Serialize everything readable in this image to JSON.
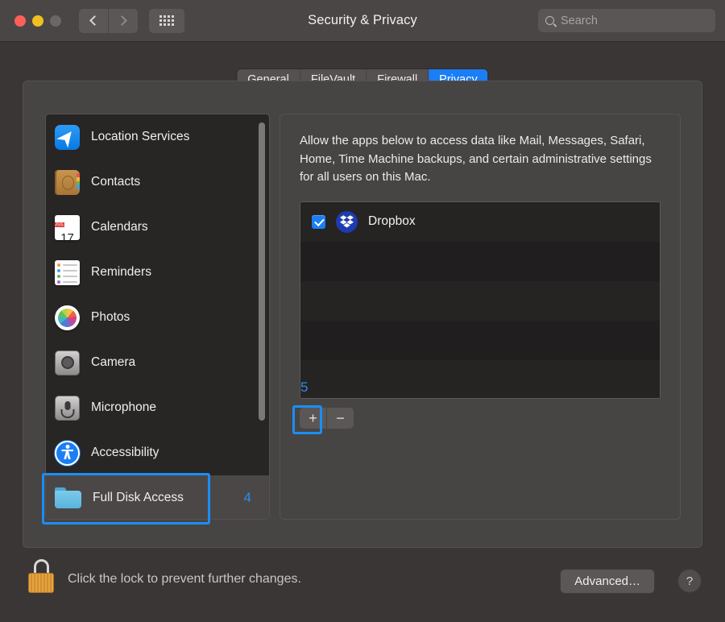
{
  "window": {
    "title": "Security & Privacy",
    "traffic_lights": [
      "close-red",
      "minimize-yellow",
      "zoom-gray"
    ],
    "nav": {
      "back": "back-chevron",
      "forward": "forward-chevron",
      "grid": "show-all-grid"
    },
    "search": {
      "placeholder": "Search",
      "value": "",
      "icon": "search-icon"
    }
  },
  "tabs": [
    {
      "label": "General",
      "active": false
    },
    {
      "label": "FileVault",
      "active": false
    },
    {
      "label": "Firewall",
      "active": false
    },
    {
      "label": "Privacy",
      "active": true
    }
  ],
  "sidebar": {
    "items": [
      {
        "label": "Location Services",
        "icon": "location-services-icon",
        "selected": false,
        "annotation": ""
      },
      {
        "label": "Contacts",
        "icon": "contacts-icon",
        "selected": false,
        "annotation": ""
      },
      {
        "label": "Calendars",
        "icon": "calendar-icon",
        "selected": false,
        "annotation": ""
      },
      {
        "label": "Reminders",
        "icon": "reminders-icon",
        "selected": false,
        "annotation": ""
      },
      {
        "label": "Photos",
        "icon": "photos-icon",
        "selected": false,
        "annotation": ""
      },
      {
        "label": "Camera",
        "icon": "camera-icon",
        "selected": false,
        "annotation": ""
      },
      {
        "label": "Microphone",
        "icon": "microphone-icon",
        "selected": false,
        "annotation": ""
      },
      {
        "label": "Accessibility",
        "icon": "accessibility-icon",
        "selected": false,
        "annotation": ""
      },
      {
        "label": "Full Disk Access",
        "icon": "folder-icon",
        "selected": true,
        "annotation": "4"
      }
    ],
    "calendar_icon": {
      "month": "JUL",
      "day": "17"
    }
  },
  "content": {
    "description": "Allow the apps below to access data like Mail, Messages, Safari, Home, Time Machine backups, and certain administrative settings for all users on this Mac.",
    "apps": [
      {
        "name": "Dropbox",
        "checked": true,
        "icon": "dropbox-icon"
      }
    ],
    "list_buttons": {
      "add": "+",
      "remove": "−"
    }
  },
  "annotations": [
    {
      "number": "4",
      "target": "sidebar-item-full-disk-access"
    },
    {
      "number": "5",
      "target": "add-app-button"
    }
  ],
  "footer": {
    "lock_icon": "unlocked-padlock-icon",
    "lock_text": "Click the lock to prevent further changes.",
    "advanced_label": "Advanced…",
    "help_label": "?"
  },
  "colors": {
    "accent_blue": "#1b7ef4",
    "annotation_blue": "#1b8ef4",
    "window_bg": "#3a3636",
    "panel_bg": "#474444",
    "sidebar_bg": "#282525",
    "list_bg": "#232020"
  }
}
